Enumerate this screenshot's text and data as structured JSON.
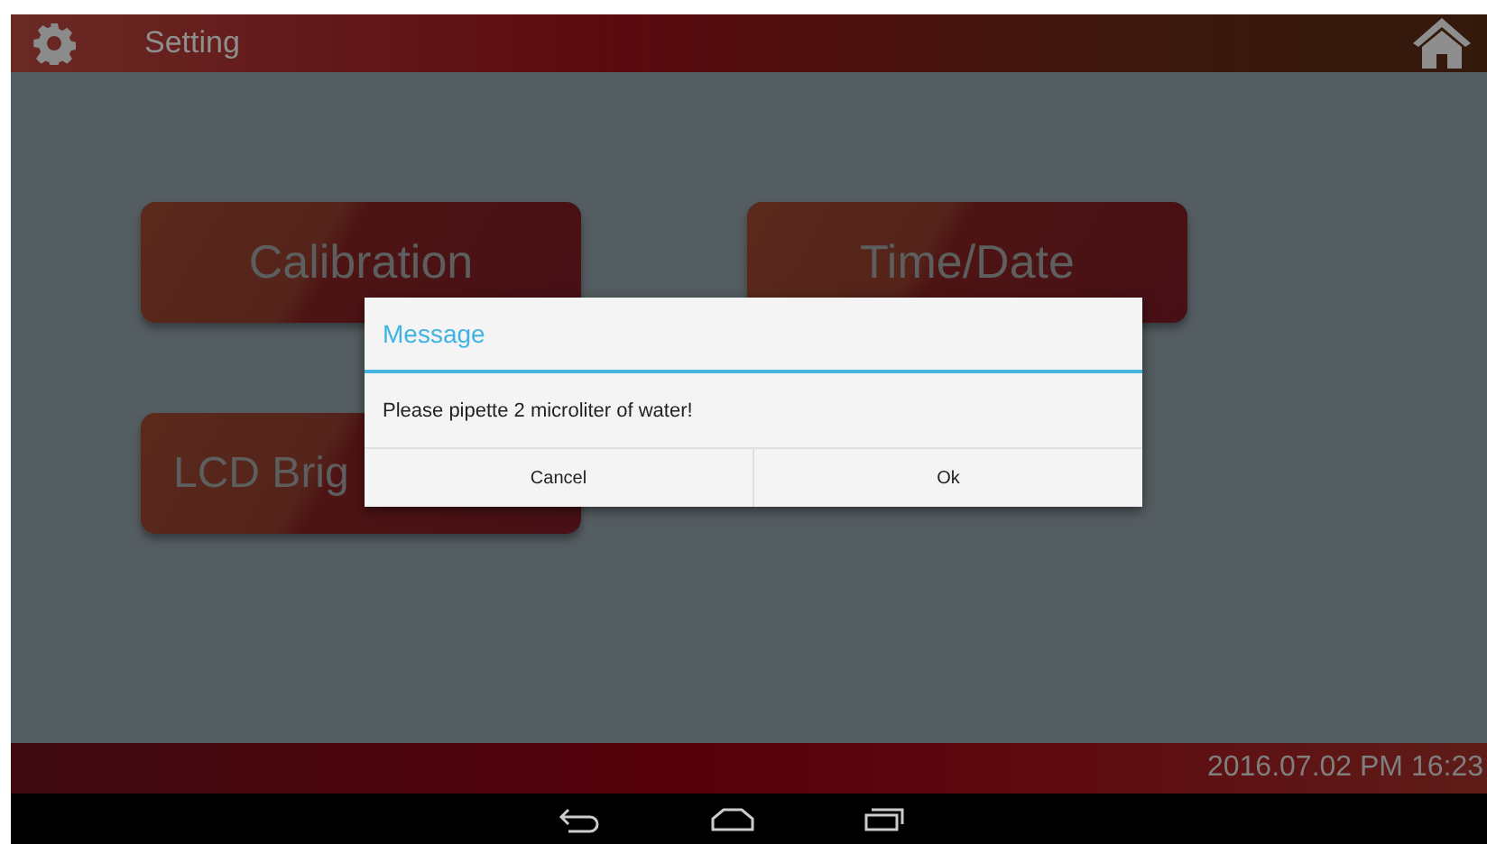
{
  "header": {
    "title": "Setting"
  },
  "menu_buttons": [
    {
      "label": "Calibration"
    },
    {
      "label": "Time/Date"
    },
    {
      "label": "LCD Brig"
    }
  ],
  "dialog": {
    "title": "Message",
    "message": "Please pipette 2 microliter of water!",
    "buttons": [
      "Cancel",
      "Ok"
    ]
  },
  "footer": {
    "datetime": "2016.07.02 PM 16:23"
  }
}
